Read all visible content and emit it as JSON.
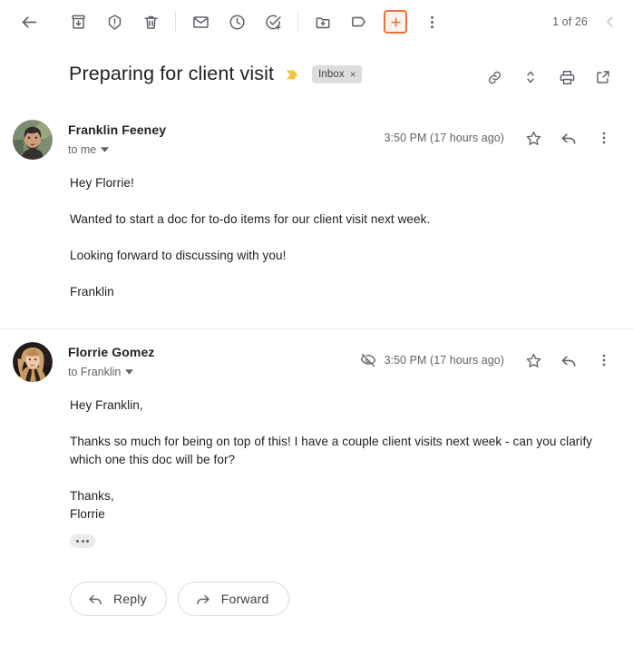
{
  "toolbar": {
    "back_label": "back-to-inbox",
    "buttons": [
      {
        "name": "archive",
        "icon": "archive-icon"
      },
      {
        "name": "report-spam",
        "icon": "report-spam-icon"
      },
      {
        "name": "delete",
        "icon": "delete-icon"
      },
      {
        "name": "mark-unread",
        "icon": "mail-icon"
      },
      {
        "name": "snooze",
        "icon": "clock-icon"
      },
      {
        "name": "add-to-tasks",
        "icon": "task-add-icon"
      },
      {
        "name": "move-to",
        "icon": "folder-move-icon"
      },
      {
        "name": "labels",
        "icon": "label-icon"
      },
      {
        "name": "add-on",
        "icon": "plus-square-icon"
      },
      {
        "name": "more-options",
        "icon": "more-vert-icon"
      }
    ],
    "pagination": "1 of 26",
    "newer_label": "newer-chevron"
  },
  "subject": {
    "title": "Preparing for client visit",
    "importance_marker": "importance-marker-icon",
    "label": "Inbox",
    "label_remove": "×",
    "actions": [
      {
        "name": "copy-link",
        "icon": "link-icon"
      },
      {
        "name": "expand-collapse",
        "icon": "unfold-icon"
      },
      {
        "name": "print-all",
        "icon": "print-icon"
      },
      {
        "name": "open-in-new-window",
        "icon": "open-new-icon"
      }
    ]
  },
  "messages": [
    {
      "sender": "Franklin Feeney",
      "recipient": "to me",
      "timestamp": "3:50 PM (17 hours ago)",
      "has_confidential_icon": false,
      "avatar_name": "avatar-franklin-feeney",
      "body": [
        "Hey Florrie!",
        "Wanted to start a doc for to-do items for our client visit next week.",
        "Looking forward to discussing with you!",
        "Franklin"
      ],
      "star_label": "star-icon",
      "reply_label": "reply-icon",
      "more_label": "more-vert-icon"
    },
    {
      "sender": "Florrie Gomez",
      "recipient": "to Franklin",
      "timestamp": "3:50 PM (17 hours ago)",
      "has_confidential_icon": true,
      "confidential_icon_name": "eye-off-icon",
      "avatar_name": "avatar-florrie-gomez",
      "body": [
        "Hey Franklin,",
        "Thanks so much for being on top of this! I have a couple client visits next week - can you clarify which one this doc will be for?",
        "Thanks,",
        "Florrie"
      ],
      "star_label": "star-icon",
      "reply_label": "reply-icon",
      "more_label": "more-vert-icon",
      "trimmed_content_label": "show-trimmed-content"
    }
  ],
  "footer": {
    "reply_label": "Reply",
    "forward_label": "Forward"
  },
  "colors": {
    "accent_orange": "#e8733d",
    "importance_yellow": "#f5c33b",
    "chip_bg": "#ddddde",
    "icon_gray": "#5f6368",
    "text_primary": "#202124"
  }
}
